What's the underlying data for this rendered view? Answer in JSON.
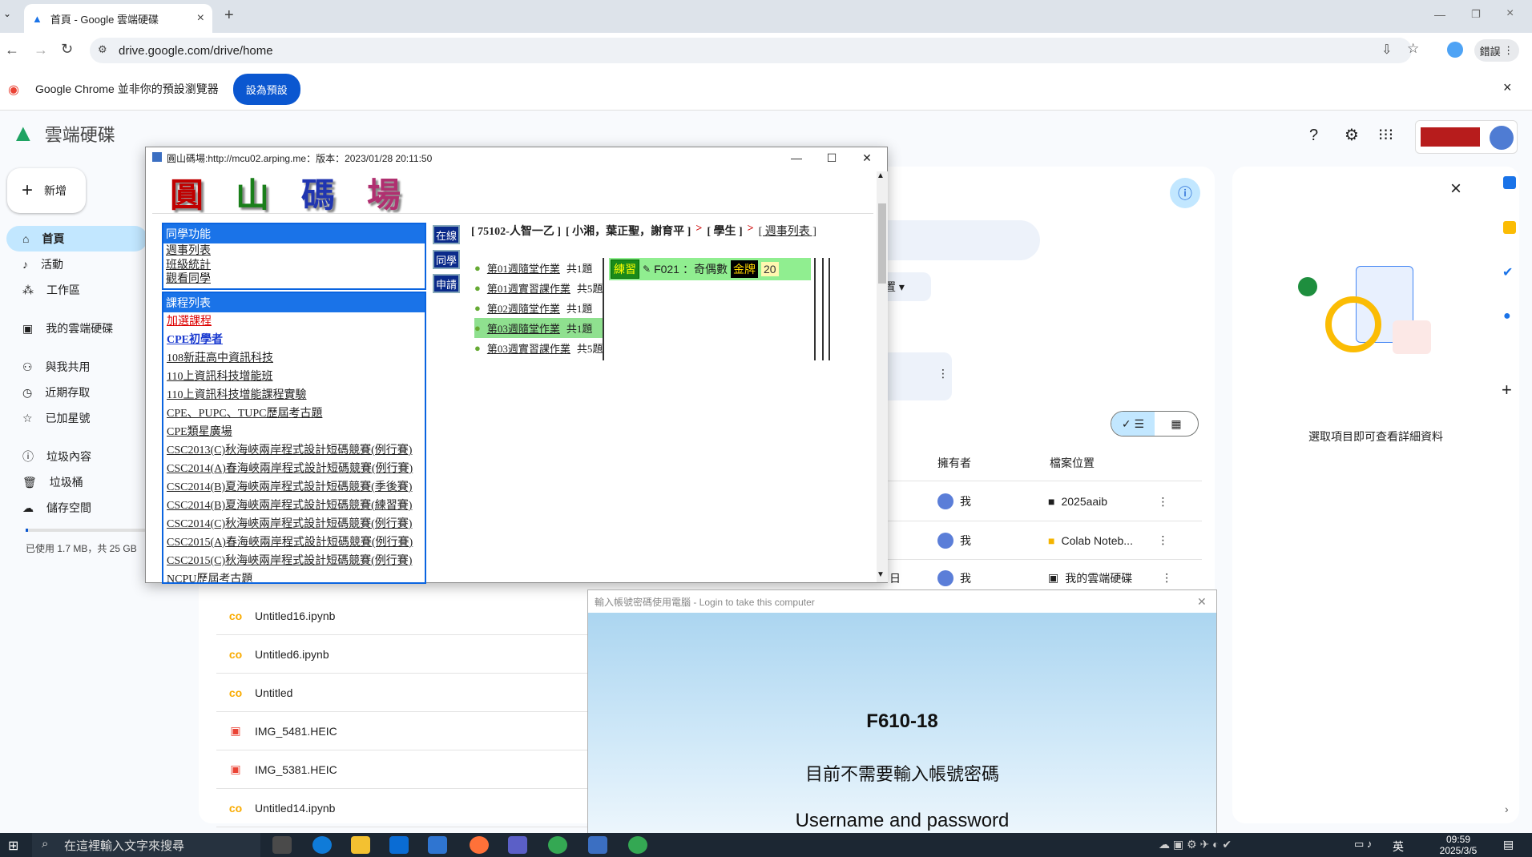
{
  "browser": {
    "tab_title": "首頁 - Google 雲端硬碟",
    "url": "drive.google.com/drive/home",
    "profile_label": "錯誤",
    "infobar_text": "Google Chrome 並非你的預設瀏覽器",
    "infobar_button": "設為預設"
  },
  "drive": {
    "app_title": "雲端硬碟",
    "new_label": "新增",
    "nav": [
      "首頁",
      "活動",
      "工作區",
      "我的雲端硬碟",
      "與我共用",
      "近期存取",
      "已加星號",
      "垃圾內容",
      "垃圾桶",
      "儲存空間"
    ],
    "storage_text": "已使用 1.7 MB，共 25 GB",
    "col_owner": "擁有者",
    "col_location": "檔案位置",
    "partial_label": "置",
    "partial_date": "日",
    "details_hint": "選取項目即可查看詳細資料",
    "rows_right": [
      {
        "owner": "我",
        "location": "2025aaib"
      },
      {
        "owner": "我",
        "location": "Colab Noteb..."
      },
      {
        "owner": "我",
        "location": "我的雲端硬碟"
      }
    ],
    "files": [
      "Untitled16.ipynb",
      "Untitled6.ipynb",
      "Untitled",
      "IMG_5481.HEIC",
      "IMG_5381.HEIC",
      "Untitled14.ipynb"
    ]
  },
  "popup": {
    "title": "圓山碼場:http://mcu02.arping.me：版本：2023/01/28 20:11:50",
    "logo_chars": [
      "圓",
      "山",
      "碼",
      "場"
    ],
    "classmate_head": "同學功能",
    "classmate_links": [
      "週事列表",
      "班級統計",
      "觀看同學"
    ],
    "course_head": "課程列表",
    "courses": [
      "加選課程",
      "CPE初學者",
      "108新莊高中資訊科技",
      "110上資訊科技增能班",
      "110上資訊科技增能課程實驗",
      "CPE、PUPC、TUPC歷屆考古題",
      "CPE類星廣場",
      "CSC2013(C)秋海峽兩岸程式設計短碼競賽(例行賽)",
      "CSC2014(A)春海峽兩岸程式設計短碼競賽(例行賽)",
      "CSC2014(B)夏海峽兩岸程式設計短碼競賽(季後賽)",
      "CSC2014(B)夏海峽兩岸程式設計短碼競賽(練習賽)",
      "CSC2014(C)秋海峽兩岸程式設計短碼競賽(例行賽)",
      "CSC2015(A)春海峽兩岸程式設計短碼競賽(例行賽)",
      "CSC2015(C)秋海峽兩岸程式設計短碼競賽(例行賽)",
      "NCPU歷屆考古題"
    ],
    "side_buttons": [
      "在線",
      "同學",
      "申請"
    ],
    "breadcrumb": [
      "[ 75102-人智一乙 ]",
      "[ 小湘，葉正聖，謝育平 ]",
      ">",
      "[ 學生 ]",
      ">",
      "[ 週事列表 ]"
    ],
    "homework": [
      {
        "title": "第01週隨堂作業",
        "count": "共1題"
      },
      {
        "title": "第01週實習課作業",
        "count": "共5題"
      },
      {
        "title": "第02週隨堂作業",
        "count": "共1題"
      },
      {
        "title": "第03週隨堂作業",
        "count": "共1題"
      },
      {
        "title": "第03週實習課作業",
        "count": "共5題"
      }
    ],
    "practice_label": "練習",
    "problem": "F021",
    "problem_name": "：奇偶數",
    "medal": "金牌",
    "score": "20"
  },
  "login": {
    "title": "輸入帳號密碼使用電腦 - Login to take this computer",
    "machine": "F610-18",
    "message": "目前不需要輸入帳號密碼",
    "message_en": "Username and password"
  },
  "taskbar": {
    "search_placeholder": "在這裡輸入文字來搜尋",
    "ime": "英",
    "time": "09:59",
    "date": "2025/3/5"
  },
  "colors": {
    "accent": "#0b57d0",
    "nav_active": "#c2e7ff",
    "popup_blue": "#1a73e8"
  }
}
